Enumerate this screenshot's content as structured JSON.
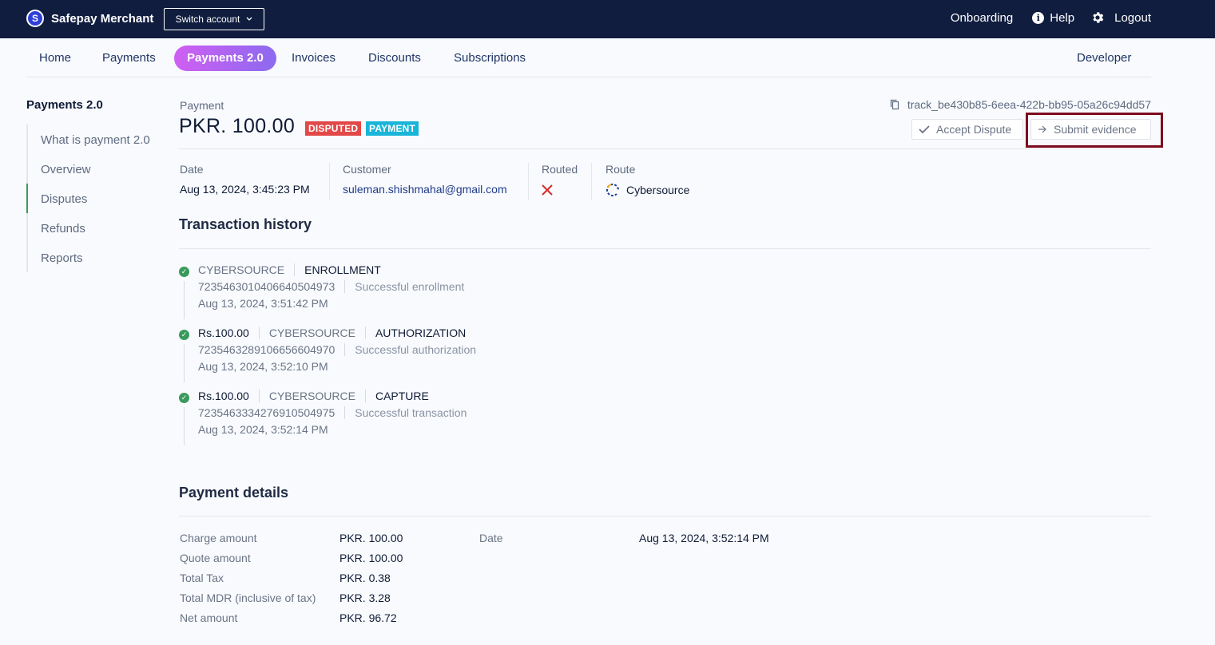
{
  "topbar": {
    "brand_letter": "S",
    "brand_name": "Safepay Merchant",
    "switch_label": "Switch account",
    "onboarding": "Onboarding",
    "help": "Help",
    "logout": "Logout"
  },
  "nav": {
    "tabs": [
      "Home",
      "Payments",
      "Payments 2.0",
      "Invoices",
      "Discounts",
      "Subscriptions"
    ],
    "active": "Payments 2.0",
    "developer": "Developer"
  },
  "sidebar": {
    "title": "Payments 2.0",
    "items": [
      "What is payment 2.0",
      "Overview",
      "Disputes",
      "Refunds",
      "Reports"
    ],
    "active": "Disputes"
  },
  "payment": {
    "label": "Payment",
    "amount": "PKR. 100.00",
    "badges": [
      "DISPUTED",
      "PAYMENT"
    ],
    "tracker": "track_be430b85-6eea-422b-bb95-05a26c94dd57",
    "accept_label": "Accept Dispute",
    "submit_label": "Submit evidence"
  },
  "meta": {
    "date_label": "Date",
    "date_value": "Aug 13, 2024, 3:45:23 PM",
    "customer_label": "Customer",
    "customer_value": "suleman.shishmahal@gmail.com",
    "routed_label": "Routed",
    "route_label": "Route",
    "route_value": "Cybersource"
  },
  "history": {
    "title": "Transaction history",
    "items": [
      {
        "amount": "",
        "provider": "CYBERSOURCE",
        "type": "ENROLLMENT",
        "ref": "7235463010406640504973",
        "message": "Successful enrollment",
        "time": "Aug 13, 2024, 3:51:42 PM"
      },
      {
        "amount": "Rs.100.00",
        "provider": "CYBERSOURCE",
        "type": "AUTHORIZATION",
        "ref": "7235463289106656604970",
        "message": "Successful authorization",
        "time": "Aug 13, 2024, 3:52:10 PM"
      },
      {
        "amount": "Rs.100.00",
        "provider": "CYBERSOURCE",
        "type": "CAPTURE",
        "ref": "7235463334276910504975",
        "message": "Successful transaction",
        "time": "Aug 13, 2024, 3:52:14 PM"
      }
    ]
  },
  "details": {
    "title": "Payment details",
    "rows": [
      {
        "label": "Charge amount",
        "value": "PKR. 100.00"
      },
      {
        "label": "Quote amount",
        "value": "PKR. 100.00"
      },
      {
        "label": "Total Tax",
        "value": "PKR. 0.38"
      },
      {
        "label": "Total MDR (inclusive of tax)",
        "value": "PKR. 3.28"
      },
      {
        "label": "Net amount",
        "value": "PKR. 96.72"
      }
    ],
    "date_label": "Date",
    "date_value": "Aug 13, 2024, 3:52:14 PM"
  },
  "colors": {
    "topbar": "#101d3f",
    "disputed": "#e34848",
    "payment_badge": "#19b5d8",
    "success": "#3a9a5b",
    "highlight": "#7d0a1e"
  }
}
